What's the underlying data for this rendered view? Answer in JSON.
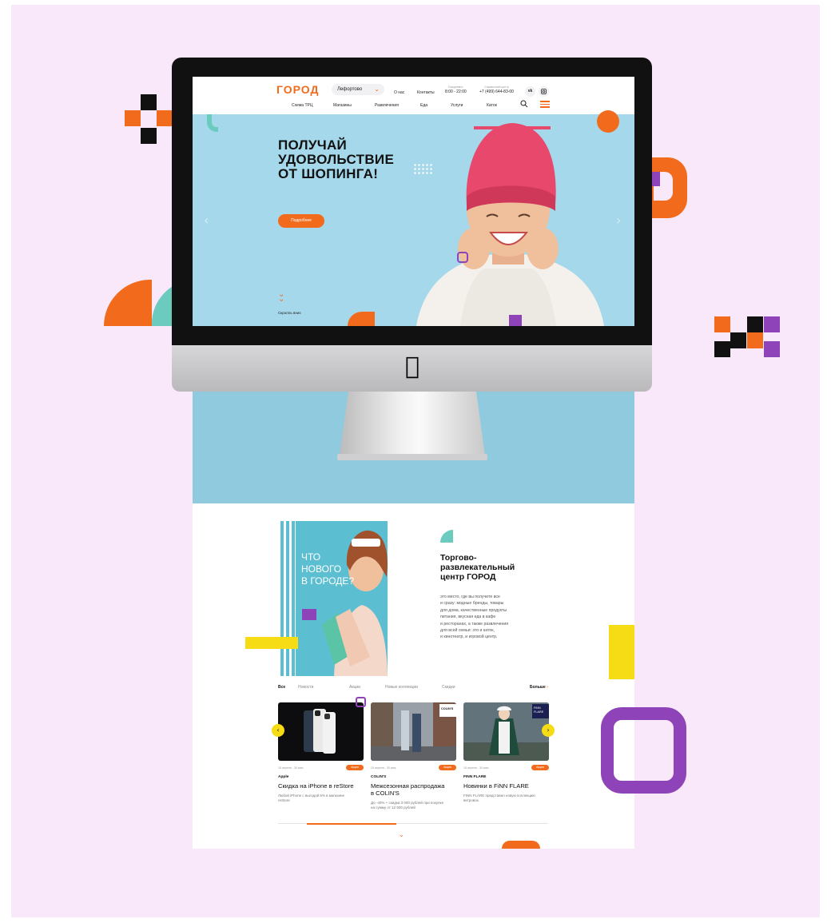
{
  "site": {
    "logo": "ГОРОД",
    "city": "Лефортово",
    "top_links": [
      "О нас",
      "Контакты"
    ],
    "hours_caption": "Ежедневно",
    "hours": "8:00 - 22:00",
    "phone_caption": "Справочный центр",
    "phone": "+7 (499) 644-83-00",
    "social": [
      "vk",
      "instagram"
    ],
    "nav": [
      "Схема ТРЦ",
      "Магазины",
      "Развлечения",
      "Еда",
      "Услуги",
      "Каток"
    ]
  },
  "hero": {
    "title_lines": [
      "ПОЛУЧАЙ",
      "УДОВОЛЬСТВИЕ",
      "ОТ ШОПИНГА!"
    ],
    "button": "Подробнее",
    "scroll_label": "Скролль вниз"
  },
  "promo": {
    "lines": [
      "ЧТО",
      "НОВОГО",
      "В ГОРОДЕ?"
    ]
  },
  "about": {
    "title_lines": [
      "Торгово-",
      "развлекательный",
      "центр ГОРОД"
    ],
    "text_lines": [
      "это место, где вы получите все",
      "и сразу: модные бренды, товары",
      "для дома, качественные продукты",
      "питания, вкусная еда в кафе",
      "и ресторанах, а также развлечения",
      "для всей семьи: это и каток,",
      "и кинотеатр, и игровой центр."
    ]
  },
  "filters": {
    "items": [
      "Все",
      "Новости",
      "Акции",
      "Новые коллекции",
      "Скидки"
    ],
    "active": "Все",
    "more": "Больше"
  },
  "cards": [
    {
      "date": "15 апреля - 30 мая",
      "badge": "Акция",
      "brand": "Apple",
      "title_lines": [
        "Скидка на iPhone в reStore"
      ],
      "desc_lines": [
        "Любой iPhone с выгодой 5% в магазине",
        "reStore"
      ]
    },
    {
      "date": "15 апреля - 30 мая",
      "badge": "Акция",
      "brand": "COLIN'S",
      "title_lines": [
        "Межсезонная распродажа",
        "в COLIN'S"
      ],
      "desc_lines": [
        "До -40% + скидка 3 000 рублей при покупке",
        "на сумму от 12 500 рублей"
      ]
    },
    {
      "date": "15 апреля - 30 мая",
      "badge": "Акция",
      "brand": "FINN FLARE",
      "title_lines": [
        "Новинки в FiNN FLARE"
      ],
      "desc_lines": [
        "FINN FLARE представил новую коллекцию",
        "ветровок."
      ]
    }
  ],
  "slider_progress": 0.33,
  "colors": {
    "accent_orange": "#f26b1d",
    "accent_yellow": "#f5dc14",
    "accent_purple": "#8e44b8",
    "accent_teal": "#6ccbbf",
    "page_bg": "#f8e8f9",
    "hero_bg": "#a4d8ea"
  }
}
